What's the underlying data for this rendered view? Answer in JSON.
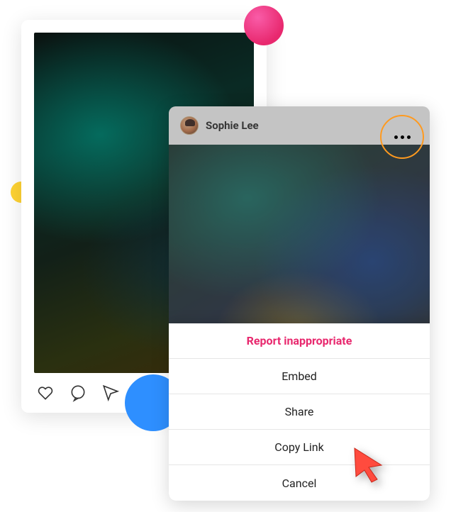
{
  "decor": {
    "colors": {
      "pink": "#e8286e",
      "yellow": "#ffd333",
      "blue": "#2e8fff",
      "highlight_ring": "#ff9a1f"
    }
  },
  "card_back": {
    "actions": {
      "heart": "heart",
      "comment": "comment",
      "share": "share"
    }
  },
  "card_front": {
    "author": "Sophie Lee"
  },
  "action_sheet": {
    "items": [
      {
        "label": "Report inappropriate",
        "danger": true
      },
      {
        "label": "Embed",
        "danger": false
      },
      {
        "label": "Share",
        "danger": false
      },
      {
        "label": "Copy Link",
        "danger": false
      },
      {
        "label": "Cancel",
        "danger": false
      }
    ]
  }
}
